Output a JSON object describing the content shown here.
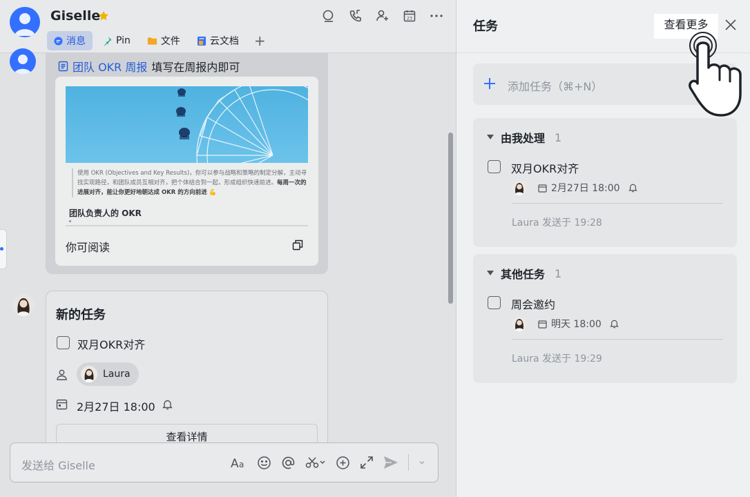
{
  "chat": {
    "contact_name": "Giselle",
    "tabs": [
      {
        "label": "消息",
        "active": true
      },
      {
        "label": "Pin"
      },
      {
        "label": "文件"
      },
      {
        "label": "云文档"
      }
    ],
    "doc_message": {
      "link_text": "团队 OKR 周报",
      "suffix_text": "填写在周报内即可",
      "preview_text_1": "使用 OKR (Objectives and Key Results)，你可以参与战略和策略的制定分解，主动寻找实现路径，和团队成员互相对齐，把个体结合到一起，形成组织快速前进。",
      "preview_text_bold": "每周一次的进展对齐，能让你更好地朝达成 OKR 的方向前进",
      "preview_emoji": "💪",
      "preview_subtitle": "团队负责人的 OKR",
      "permission_text": "你可阅读"
    },
    "task_card": {
      "title": "新的任务",
      "task_name": "双月OKR对齐",
      "assignee": "Laura",
      "due": "2月27日 18:00",
      "button_label": "查看详情"
    },
    "composer": {
      "placeholder": "发送给 Giselle"
    }
  },
  "tasks_panel": {
    "title": "任务",
    "more_label": "查看更多",
    "add_task_label": "添加任务（⌘+N）",
    "groups": [
      {
        "title": "由我处理",
        "count": "1",
        "task": "双月OKR对齐",
        "due": "2月27日 18:00",
        "sent_by": "Laura 发送于 19:28"
      },
      {
        "title": "其他任务",
        "count": "1",
        "task": "周会邀约",
        "due": "明天 18:00",
        "sent_by": "Laura 发送于 19:29"
      }
    ]
  },
  "colors": {
    "accent": "#3370ff",
    "link": "#245bdb",
    "star": "#f0b400"
  },
  "icons": [
    "star-icon",
    "search-chat-icon",
    "call-icon",
    "add-member-icon",
    "calendar-icon",
    "more-icon",
    "close-icon",
    "plus-icon",
    "checkbox-icon",
    "bell-icon",
    "send-icon",
    "pointer-hand-icon"
  ]
}
